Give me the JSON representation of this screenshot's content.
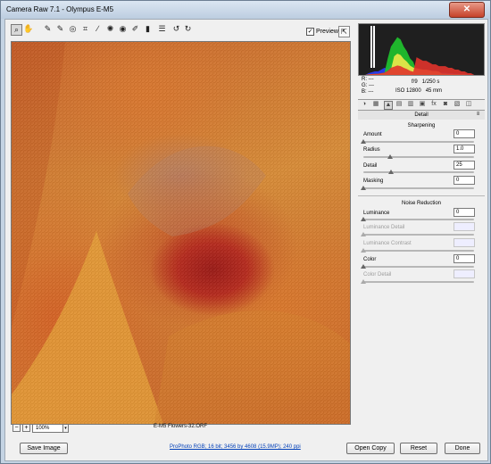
{
  "window": {
    "title": "Camera Raw 7.1  -  Olympus E-M5",
    "close_glyph": "✕"
  },
  "toolbar": {
    "tools": [
      {
        "icon": "zoom-icon",
        "glyph": "⌕"
      },
      {
        "icon": "hand-icon",
        "glyph": "✋"
      },
      {
        "icon": "white-balance-icon",
        "glyph": "✎"
      },
      {
        "icon": "color-sampler-icon",
        "glyph": "✎"
      },
      {
        "icon": "targeted-adjustment-icon",
        "glyph": "◎"
      },
      {
        "icon": "crop-icon",
        "glyph": "⌗"
      },
      {
        "icon": "straighten-icon",
        "glyph": "∕"
      },
      {
        "icon": "spot-removal-icon",
        "glyph": "✺"
      },
      {
        "icon": "red-eye-icon",
        "glyph": "◉"
      },
      {
        "icon": "adjustment-brush-icon",
        "glyph": "✐"
      },
      {
        "icon": "graduated-filter-icon",
        "glyph": "▮"
      },
      {
        "icon": "preferences-icon",
        "glyph": "☰"
      },
      {
        "icon": "rotate-left-icon",
        "glyph": "↺"
      },
      {
        "icon": "rotate-right-icon",
        "glyph": "↻"
      }
    ],
    "preview_label": "Preview",
    "preview_check": "✓",
    "fullscreen_glyph": "⇱"
  },
  "zoom": {
    "minus": "−",
    "plus": "+",
    "value": "100%",
    "arrow": "▾"
  },
  "image": {
    "filename": "E-M5 Flowers-32.ORF"
  },
  "histogram": {
    "bins": [
      0,
      0,
      0,
      2,
      3,
      4,
      4,
      6,
      8,
      14,
      24,
      28,
      32,
      30,
      24,
      20,
      14,
      11,
      10,
      9,
      8,
      8,
      7,
      6,
      6,
      5,
      5,
      5,
      4,
      4,
      3,
      3,
      2,
      2,
      1,
      1,
      0,
      0,
      0,
      0
    ],
    "top_spikes": [
      38,
      41
    ],
    "colors": {
      "blue": "#2a3cff",
      "green": "#1fc52e",
      "yellow": "#f0e84a",
      "red": "#e0332b",
      "white": "#ffffff"
    }
  },
  "readout": {
    "r": "R:  ---",
    "g": "G:  ---",
    "b": "B:  ---",
    "aperture": "f/9",
    "shutter": "1/250 s",
    "iso": "ISO 12800",
    "focal": "45 mm"
  },
  "tabs": [
    {
      "icon": "basic-icon",
      "glyph": "◑"
    },
    {
      "icon": "tone-curve-icon",
      "glyph": "▦"
    },
    {
      "icon": "detail-icon",
      "glyph": "▲"
    },
    {
      "icon": "hsl-icon",
      "glyph": "▤"
    },
    {
      "icon": "split-toning-icon",
      "glyph": "▥"
    },
    {
      "icon": "lens-corrections-icon",
      "glyph": "▣"
    },
    {
      "icon": "effects-icon",
      "glyph": "fx"
    },
    {
      "icon": "camera-calibration-icon",
      "glyph": "◙"
    },
    {
      "icon": "presets-icon",
      "glyph": "▧"
    },
    {
      "icon": "snapshots-icon",
      "glyph": "◫"
    }
  ],
  "panel": {
    "title": "Detail",
    "menu_glyph": "≡"
  },
  "sharpening": {
    "title": "Sharpening",
    "amount": {
      "label": "Amount",
      "value": "0",
      "position": 0.0
    },
    "radius": {
      "label": "Radius",
      "value": "1.0",
      "position": 0.24
    },
    "detail": {
      "label": "Detail",
      "value": "25",
      "position": 0.25
    },
    "masking": {
      "label": "Masking",
      "value": "0",
      "position": 0.0
    }
  },
  "noise": {
    "title": "Noise Reduction",
    "luminance": {
      "label": "Luminance",
      "value": "0",
      "position": 0.0
    },
    "luminance_detail": {
      "label": "Luminance Detail",
      "value": "",
      "position": 0.0
    },
    "luminance_contrast": {
      "label": "Luminance Contrast",
      "value": "",
      "position": 0.0
    },
    "color": {
      "label": "Color",
      "value": "0",
      "position": 0.0
    },
    "color_detail": {
      "label": "Color Detail",
      "value": "",
      "position": 0.0
    }
  },
  "footer": {
    "save_label": "Save Image",
    "info_link": "ProPhoto RGB; 16 bit; 3456 by 4608 (15.9MP); 240 ppi",
    "open_label": "Open Copy",
    "reset_label": "Reset",
    "done_label": "Done"
  }
}
